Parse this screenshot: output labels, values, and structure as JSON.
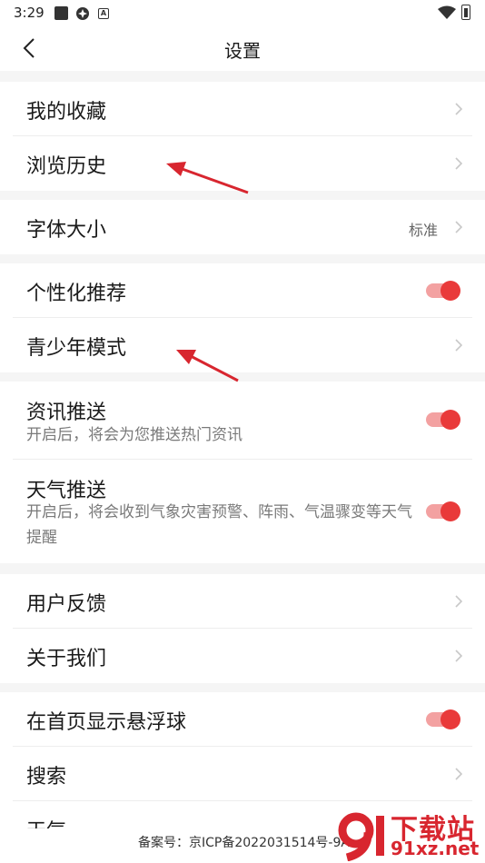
{
  "status_bar": {
    "time": "3:29"
  },
  "header": {
    "title": "设置"
  },
  "groups": [
    {
      "items": [
        {
          "label": "我的收藏"
        },
        {
          "label": "浏览历史"
        }
      ]
    },
    {
      "items": [
        {
          "label": "字体大小",
          "value": "标准"
        }
      ]
    },
    {
      "items": [
        {
          "label": "个性化推荐",
          "toggle": "on"
        },
        {
          "label": "青少年模式"
        }
      ]
    },
    {
      "items": [
        {
          "label": "资讯推送",
          "desc": "开启后，将会为您推送热门资讯",
          "toggle": "on"
        },
        {
          "label": "天气推送",
          "desc": "开启后，将会收到气象灾害预警、阵雨、气温骤变等天气提醒",
          "toggle": "on"
        }
      ]
    },
    {
      "items": [
        {
          "label": "用户反馈"
        },
        {
          "label": "关于我们"
        }
      ]
    },
    {
      "items": [
        {
          "label": "在首页显示悬浮球",
          "toggle": "on"
        },
        {
          "label": "搜索"
        },
        {
          "label": "天气"
        }
      ]
    }
  ],
  "footer": {
    "icp": "备案号：京ICP备2022031514号-9A"
  },
  "watermark": {
    "main": "下载站",
    "url": "91xz.net"
  },
  "colors": {
    "accent": "#e93a3a",
    "toggle_track": "#f3a1a1",
    "annotation_arrow": "#d8262f"
  }
}
